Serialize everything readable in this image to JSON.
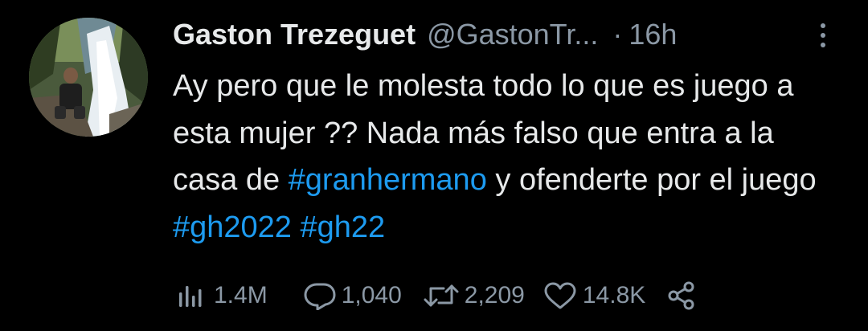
{
  "tweet": {
    "author": {
      "name": "Gaston Trezeguet",
      "handle": "@GastonTr...",
      "avatar_icon": "profile-photo-waterfall"
    },
    "separator": "·",
    "time": "16h",
    "more_icon": "more-vertical-icon",
    "text": {
      "segments": [
        {
          "text": "Ay pero que le molesta todo lo que es juego a esta mujer ?? Nada más falso que entra a la casa de ",
          "type": "plain"
        },
        {
          "text": "#granhermano",
          "type": "hashtag"
        },
        {
          "text": " y ofenderte por el juego ",
          "type": "plain"
        },
        {
          "text": "#gh2022",
          "type": "hashtag"
        },
        {
          "text": " ",
          "type": "plain"
        },
        {
          "text": "#gh22",
          "type": "hashtag"
        }
      ]
    },
    "stats": {
      "views": "1.4M",
      "replies": "1,040",
      "retweets": "2,209",
      "likes": "14.8K"
    },
    "colors": {
      "background": "#000000",
      "text": "#e7e9ea",
      "secondary": "#8b98a5",
      "link": "#1d9bf0"
    }
  }
}
